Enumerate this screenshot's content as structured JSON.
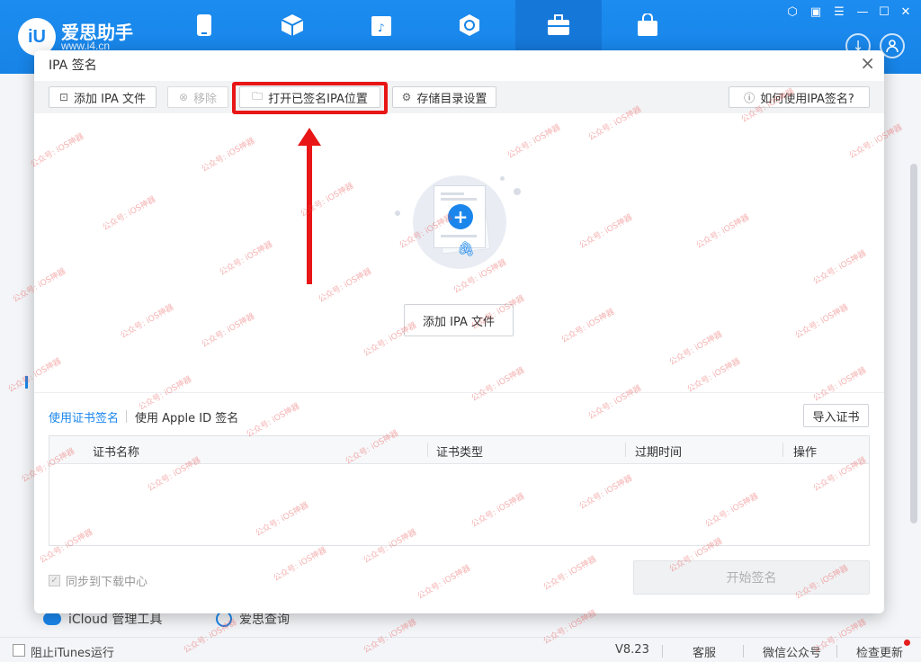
{
  "app": {
    "brand": "爱思助手",
    "url": "www.i4.cn",
    "logo_text": "iU"
  },
  "dialog": {
    "title": "IPA 签名",
    "toolbar": {
      "add_ipa": "添加 IPA 文件",
      "remove": "移除",
      "open_signed": "打开已签名IPA位置",
      "storage": "存储目录设置",
      "howto": "如何使用IPA签名?"
    },
    "add_ipa_center": "添加 IPA 文件",
    "tabs": {
      "cert": "使用证书签名",
      "apple_id": "使用 Apple ID 签名"
    },
    "import_cert": "导入证书",
    "table_headers": [
      "证书名称",
      "证书类型",
      "过期时间",
      "操作"
    ],
    "sync_label": "同步到下载中心",
    "start_sign": "开始签名"
  },
  "background": {
    "icloud": "iCloud 管理工具",
    "query": "爱思查询"
  },
  "statusbar": {
    "block_itunes": "阻止iTunes运行",
    "version": "V8.23",
    "service": "客服",
    "wechat": "微信公众号",
    "update": "检查更新"
  },
  "watermark": "公众号: iOS神器",
  "colors": {
    "brand_blue": "#1a86ec",
    "highlight_red": "#e81616"
  }
}
